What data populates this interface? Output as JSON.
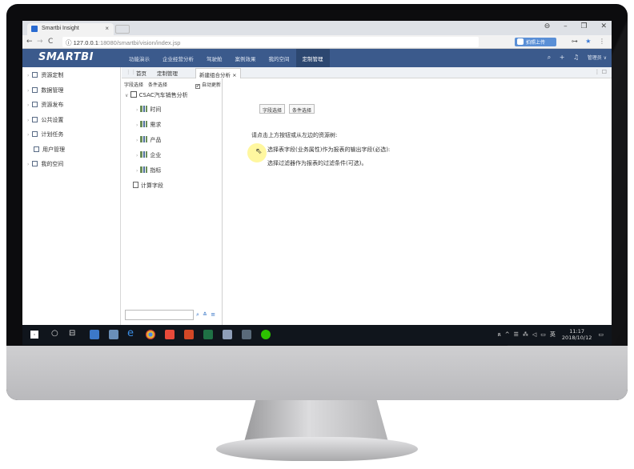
{
  "browser": {
    "tab_title": "Smartbi Insight",
    "tab_close": "×",
    "url_host": "127.0.0.1",
    "url_path": ":18080/smartbi/vision/index.jsp",
    "ext_button": "拍照上传",
    "window_controls": [
      "⊖",
      "–",
      "❐",
      "✕"
    ],
    "nav": {
      "back": "←",
      "forward": "→",
      "reload": "C",
      "info": "ⓘ"
    },
    "addr_icons": {
      "key": "⊶",
      "star": "★",
      "menu": "⋮"
    }
  },
  "app": {
    "logo": "SMARTBI",
    "nav_items": [
      "功能演示",
      "企业经营分析",
      "驾驶舱",
      "案例效果",
      "我的空间",
      "定制管理"
    ],
    "active_nav": "定制管理",
    "header_icons": {
      "search": "⌕",
      "add": "+",
      "bell": "♫"
    },
    "user": "管理员 ∨"
  },
  "sidebar": {
    "items": [
      {
        "label": "资源定制",
        "arrow": true
      },
      {
        "label": "数据管理",
        "arrow": true
      },
      {
        "label": "资源发布",
        "arrow": true
      },
      {
        "label": "公共设置",
        "arrow": true
      },
      {
        "label": "计划任务",
        "arrow": true
      },
      {
        "label": "用户管理",
        "arrow": false
      },
      {
        "label": "我的空间",
        "arrow": true
      }
    ]
  },
  "inner_tabs": {
    "home": "首页",
    "custom": "定制管理",
    "active": "新建组合分析",
    "close": "×",
    "right_icons": "⋮ ☐"
  },
  "field_panel": {
    "toolbar": [
      "字段选择",
      "条件选择"
    ],
    "auto_refresh_label": "自动更新",
    "auto_refresh_checked": "✔",
    "root": "CSAC汽车销售分析",
    "nodes": [
      "时间",
      "需求",
      "产品",
      "企业",
      "指标"
    ],
    "calc": "计算字段",
    "search_icons": [
      "⌕",
      "≛",
      "≡"
    ]
  },
  "content": {
    "buttons": [
      "字段选择",
      "条件选择"
    ],
    "guide_title": "请点击上方按钮或从左边的资源树:",
    "guide_step1": "选择表字段(业务属性)作为报表的输出字段(必选):",
    "guide_step2": "选择过滤器作为报表的过滤条件(可选)。"
  },
  "taskbar": {
    "tray": [
      "ጸ",
      "^",
      "☰",
      "⁂",
      "◁",
      "▭",
      "英"
    ],
    "time": "11:17",
    "date": "2018/10/12",
    "notify": "▭"
  }
}
